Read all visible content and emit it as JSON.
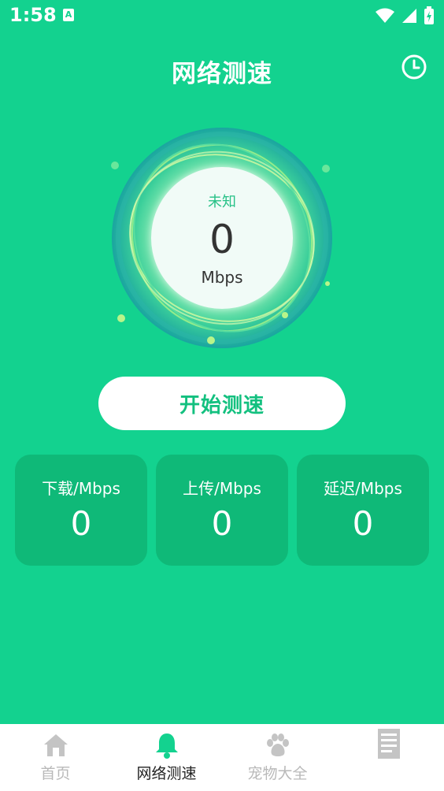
{
  "status_bar": {
    "time": "1:58",
    "app_icon_letter": "A"
  },
  "header": {
    "title": "网络测速"
  },
  "gauge": {
    "status": "未知",
    "value": "0",
    "unit": "Mbps"
  },
  "start_button": {
    "label": "开始测速"
  },
  "stats": [
    {
      "label": "下载/Mbps",
      "value": "0"
    },
    {
      "label": "上传/Mbps",
      "value": "0"
    },
    {
      "label": "延迟/Mbps",
      "value": "0"
    }
  ],
  "tabbar": {
    "items": [
      {
        "label": "首页",
        "icon": "home-icon"
      },
      {
        "label": "网络测速",
        "icon": "bell-icon"
      },
      {
        "label": "宠物大全",
        "icon": "paw-icon"
      },
      {
        "label": "",
        "icon": "document-icon"
      }
    ]
  },
  "colors": {
    "background": "#13d28f",
    "card": "#0fb978",
    "accent": "#13c07f"
  }
}
